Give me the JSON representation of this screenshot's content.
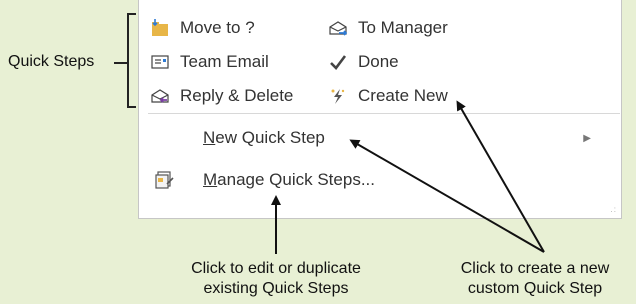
{
  "callouts": {
    "quick_steps": "Quick Steps",
    "edit_existing_line1": "Click to edit or duplicate",
    "edit_existing_line2": "existing Quick Steps",
    "create_new_line1": "Click to create a new",
    "create_new_line2": "custom Quick Step"
  },
  "quick_steps": {
    "move_to": "Move to ?",
    "team_email": "Team Email",
    "reply_delete": "Reply & Delete",
    "to_manager": "To Manager",
    "done": "Done",
    "create_new": "Create New"
  },
  "menu": {
    "new_quick_step": {
      "first": "N",
      "rest": "ew Quick Step"
    },
    "manage_quick_steps": {
      "first": "M",
      "rest": "anage Quick Steps..."
    }
  },
  "colors": {
    "background": "#e8f0d4",
    "folder": "#e8b647",
    "done_check": "#444",
    "accent_blue": "#2f7bd4",
    "reply_purple": "#7b3fa3"
  }
}
